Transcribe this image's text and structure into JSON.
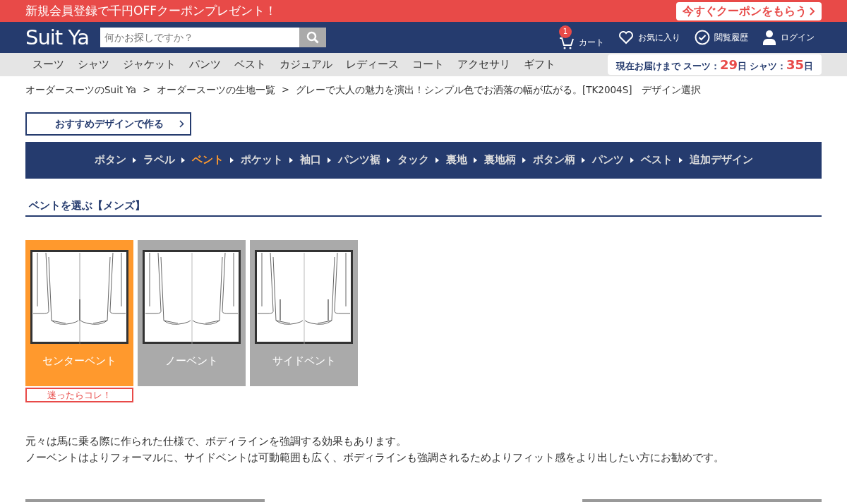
{
  "promo_bar": {
    "text": "新規会員登録で千円OFFクーポンプレゼント！",
    "button": "今すぐクーポンをもらう"
  },
  "header": {
    "logo": "Suit Ya",
    "search": {
      "placeholder": "何かお探しですか？"
    },
    "links": [
      {
        "kind": "cart",
        "label": "カート",
        "count": "1"
      },
      {
        "kind": "heart",
        "label": "お気に入り"
      },
      {
        "kind": "check",
        "label": "閲覧履歴"
      },
      {
        "kind": "user",
        "label": "ログイン"
      }
    ]
  },
  "category_nav": [
    "スーツ",
    "シャツ",
    "ジャケット",
    "パンツ",
    "ベスト",
    "カジュアル",
    "レディース",
    "コート",
    "アクセサリ",
    "ギフト"
  ],
  "delivery": {
    "label": "現在お届けまで",
    "suits_label": "スーツ：",
    "suits_days": "29",
    "suits_unit": "日",
    "shirts_label": "シャツ：",
    "shirts_days": "35",
    "shirts_unit": "日"
  },
  "breadcrumb_separators": [
    ">",
    ">"
  ],
  "breadcrumb": [
    "オーダースーツのSuit Ya",
    "オーダースーツの生地一覧",
    "グレーで大人の魅力を演出！シンプル色でお洒落の幅が広がる。[TK2004S]　デザイン選択"
  ],
  "recommend_button": "おすすめデザインで作る",
  "steps": [
    {
      "label": "ボタン",
      "selected": false
    },
    {
      "label": "ラペル",
      "selected": false
    },
    {
      "label": "ベント",
      "selected": true
    },
    {
      "label": "ポケット",
      "selected": false
    },
    {
      "label": "袖口",
      "selected": false
    },
    {
      "label": "パンツ裾",
      "selected": false
    },
    {
      "label": "タック",
      "selected": false
    },
    {
      "label": "裏地",
      "selected": false
    },
    {
      "label": "裏地柄",
      "selected": false
    },
    {
      "label": "ボタン柄",
      "selected": false
    },
    {
      "label": "パンツ",
      "selected": false
    },
    {
      "label": "ベスト",
      "selected": false
    },
    {
      "label": "追加デザイン",
      "selected": false
    }
  ],
  "section_title": "ベントを選ぶ【メンズ】",
  "options": [
    {
      "label": "センターベント",
      "kind": "center",
      "selected": true,
      "recommend_label": "迷ったらコレ！"
    },
    {
      "label": "ノーベント",
      "kind": "none",
      "selected": false
    },
    {
      "label": "サイドベント",
      "kind": "side",
      "selected": false
    }
  ],
  "description": [
    "元々は馬に乗る際に作られた仕様で、ボディラインを強調する効果もあります。",
    "ノーベントはよりフォーマルに、サイドベントは可動範囲も広く、ボディラインも強調されるためよりフィット感をより出したい方にお勧めです。"
  ]
}
